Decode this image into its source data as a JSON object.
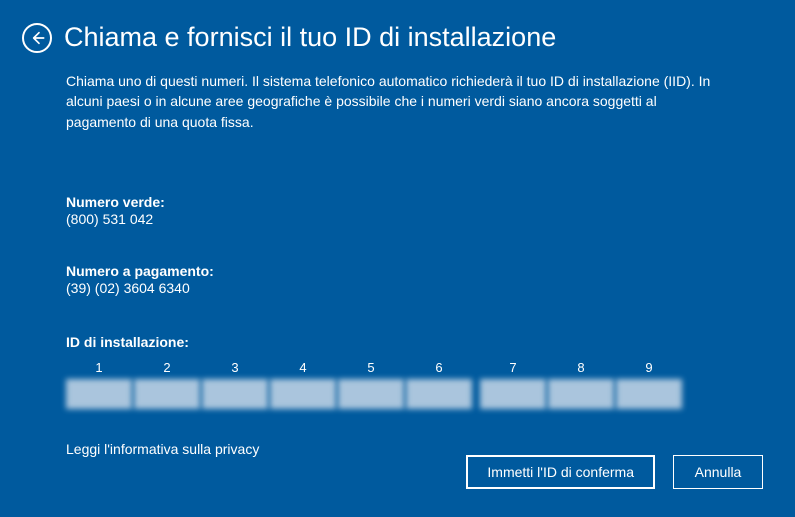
{
  "header": {
    "title": "Chiama e fornisci il tuo ID di installazione"
  },
  "description": "Chiama uno di questi numeri. Il sistema telefonico automatico richiederà il tuo ID di installazione (IID). In alcuni paesi o in alcune aree geografiche è possibile che i numeri verdi siano ancora soggetti al pagamento di una quota fissa.",
  "phones": {
    "toll_free_label": "Numero verde:",
    "toll_free_value": "(800) 531 042",
    "toll_label": "Numero a pagamento:",
    "toll_value": "(39) (02) 3604 6340"
  },
  "iid": {
    "label": "ID di installazione:",
    "columns": [
      "1",
      "2",
      "3",
      "4",
      "5",
      "6",
      "7",
      "8",
      "9"
    ]
  },
  "privacy_link": "Leggi l'informativa sulla privacy",
  "buttons": {
    "confirm": "Immetti l'ID di conferma",
    "cancel": "Annulla"
  }
}
